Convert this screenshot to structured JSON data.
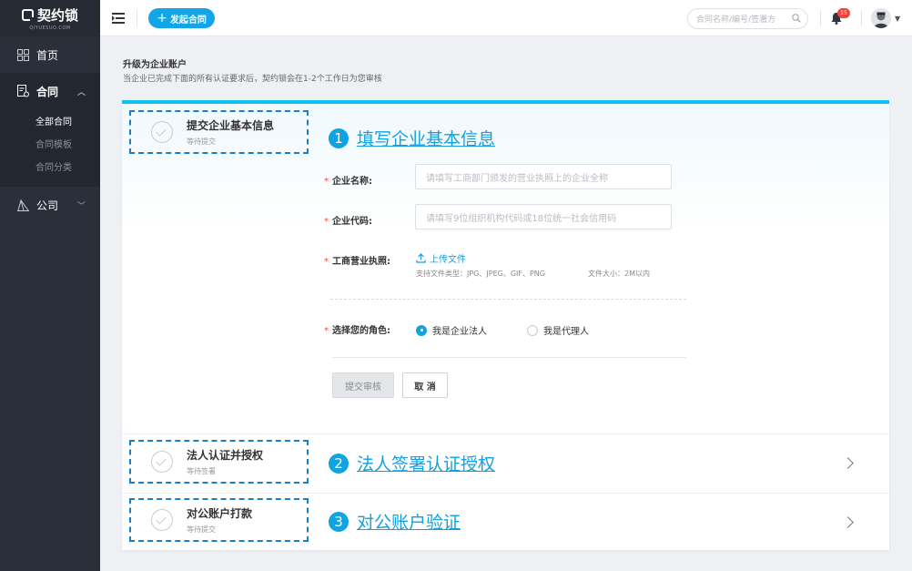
{
  "logo": {
    "name": "契约锁",
    "sub": "QIYUESUO.COM"
  },
  "sidebar": {
    "items": [
      {
        "label": "首页",
        "icon": "dashboard-icon"
      },
      {
        "label": "合同",
        "icon": "contract-icon",
        "expanded": true,
        "children": [
          "全部合同",
          "合同模板",
          "合同分类"
        ],
        "active_child": "全部合同"
      },
      {
        "label": "公司",
        "icon": "company-icon"
      }
    ]
  },
  "topbar": {
    "new_button": "发起合同",
    "search_placeholder": "合同名称/编号/签署方",
    "notification_count": "15"
  },
  "page": {
    "title": "升级为企业账户",
    "description": "当企业已完成下面的所有认证要求后，契约锁会在1-2个工作日为您审核"
  },
  "steps": [
    {
      "number": "1",
      "box_title": "提交企业基本信息",
      "box_status": "等待提交",
      "heading": "填写企业基本信息"
    },
    {
      "number": "2",
      "box_title": "法人认证并授权",
      "box_status": "等待签署",
      "heading": "法人签署认证授权"
    },
    {
      "number": "3",
      "box_title": "对公账户打款",
      "box_status": "等待提交",
      "heading": "对公账户验证"
    }
  ],
  "form": {
    "company_name": {
      "label": "企业名称:",
      "placeholder": "请填写工商部门颁发的营业执照上的企业全称",
      "value": ""
    },
    "company_code": {
      "label": "企业代码:",
      "placeholder": "请填写9位组织机构代码或18位统一社会信用码",
      "value": ""
    },
    "license": {
      "label": "工商营业执照:",
      "upload_label": "上传文件",
      "hint_types": "支持文件类型：JPG、JPEG、GIF、PNG",
      "hint_size": "文件大小：2M以内"
    },
    "role": {
      "label": "选择您的角色:",
      "options": [
        "我是企业法人",
        "我是代理人"
      ],
      "selected": "我是企业法人"
    },
    "submit_label": "提交审核",
    "cancel_label": "取 消"
  },
  "colors": {
    "accent": "#12a5e7",
    "sidebar_bg": "#2b2f3a",
    "required": "#f24a3c",
    "badge": "#f5443c"
  }
}
